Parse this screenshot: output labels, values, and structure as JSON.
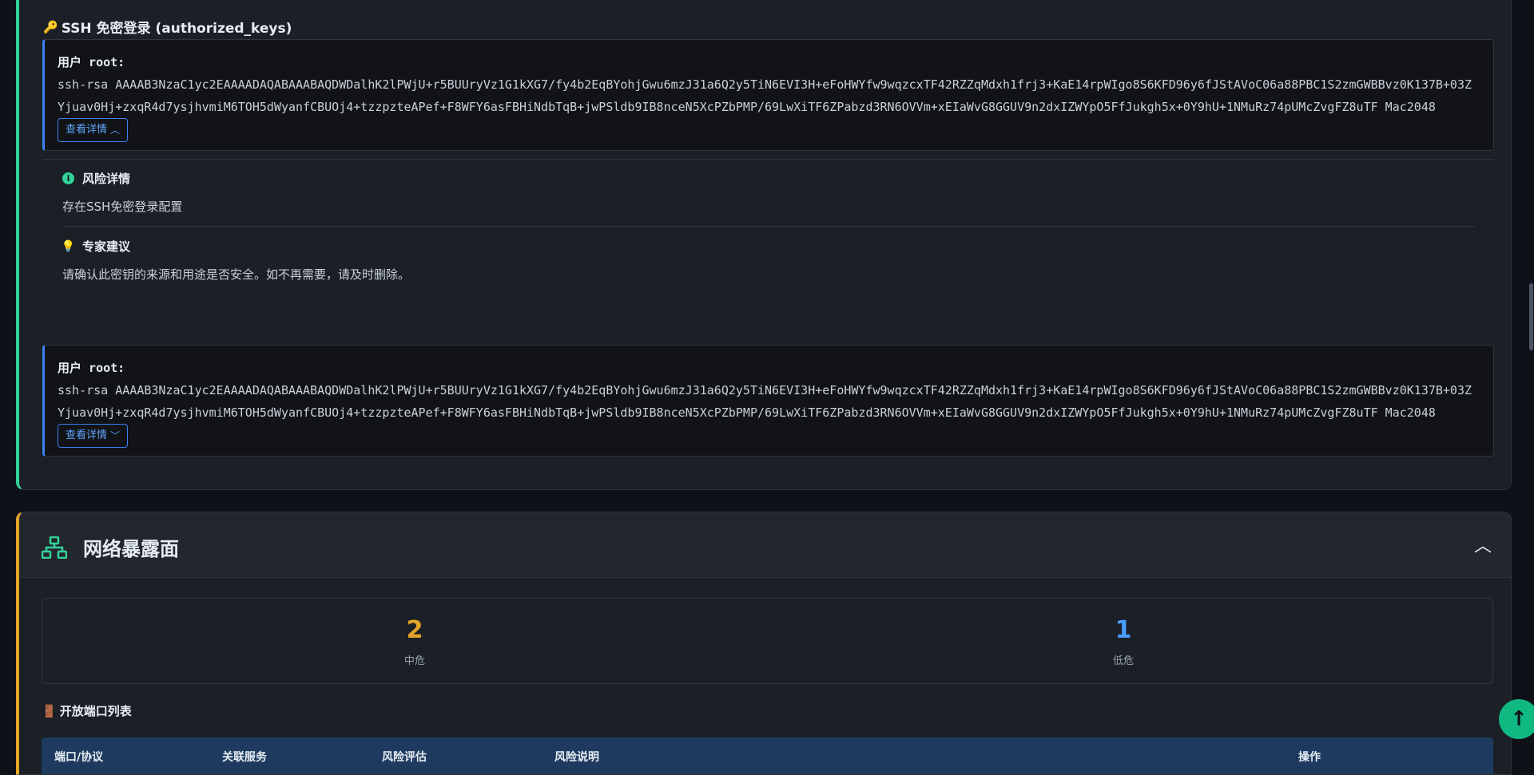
{
  "ssh": {
    "title": "SSH 免密登录 (authorized_keys)",
    "entries": [
      {
        "user_label": "用户",
        "user": "root:",
        "key": "ssh-rsa AAAAB3NzaC1yc2EAAAADAQABAAABAQDWDalhK2lPWjU+r5BUUryVz1G1kXG7/fy4b2EqBYohjGwu6mzJ31a6Q2y5TiN6EVI3H+eFoHWYfw9wqzcxTF42RZZqMdxh1frj3+KaE14rpWIgo8S6KFD96y6fJStAVoC06a88PBC1S2zmGWBBvz0K137B+03ZYjuav0Hj+zxqR4d7ysjhvmiM6TOH5dWyanfCBUOj4+tzzpzteAPef+F8WFY6asFBHiNdbTqB+jwPSldb9IB8nceN5XcPZbPMP/69LwXiTF6ZPabzd3RN6OVVm+xEIaWvG8GGUV9n2dxIZWYpO5FfJukgh5x+0Y9hU+1NMuRz74pUMcZvgFZ8uTF Mac2048",
        "button": "查看详情",
        "expanded": true
      },
      {
        "user_label": "用户",
        "user": "root:",
        "key": "ssh-rsa AAAAB3NzaC1yc2EAAAADAQABAAABAQDWDalhK2lPWjU+r5BUUryVz1G1kXG7/fy4b2EqBYohjGwu6mzJ31a6Q2y5TiN6EVI3H+eFoHWYfw9wqzcxTF42RZZqMdxh1frj3+KaE14rpWIgo8S6KFD96y6fJStAVoC06a88PBC1S2zmGWBBvz0K137B+03ZYjuav0Hj+zxqR4d7ysjhvmiM6TOH5dWyanfCBUOj4+tzzpzteAPef+F8WFY6asFBHiNdbTqB+jwPSldb9IB8nceN5XcPZbPMP/69LwXiTF6ZPabzd3RN6OVVm+xEIaWvG8GGUV9n2dxIZWYpO5FfJukgh5x+0Y9hU+1NMuRz74pUMcZvgFZ8uTF Mac2048",
        "button": "查看详情",
        "expanded": false
      }
    ],
    "risk_title": "风险详情",
    "risk_text": "存在SSH免密登录配置",
    "advice_title": "专家建议",
    "advice_text": "请确认此密钥的来源和用途是否安全。如不再需要，请及时删除。"
  },
  "network": {
    "title": "网络暴露面",
    "stats": [
      {
        "value": "2",
        "label": "中危",
        "color": "#e5a52a"
      },
      {
        "value": "1",
        "label": "低危",
        "color": "#4a9eff"
      }
    ],
    "ports_title": "开放端口列表",
    "table_headers": [
      "端口/协议",
      "关联服务",
      "风险评估",
      "风险说明",
      "操作"
    ]
  },
  "icons": {
    "key": "key-icon",
    "info": "info-icon",
    "bulb": "lightbulb-icon",
    "network": "network-icon",
    "door": "door-icon",
    "chevron_up": "chevron-up-icon",
    "arrow_up": "arrow-up-icon"
  },
  "colors": {
    "accent_green": "#34d399",
    "accent_orange": "#e5a52a",
    "accent_blue": "#3b82f6"
  }
}
